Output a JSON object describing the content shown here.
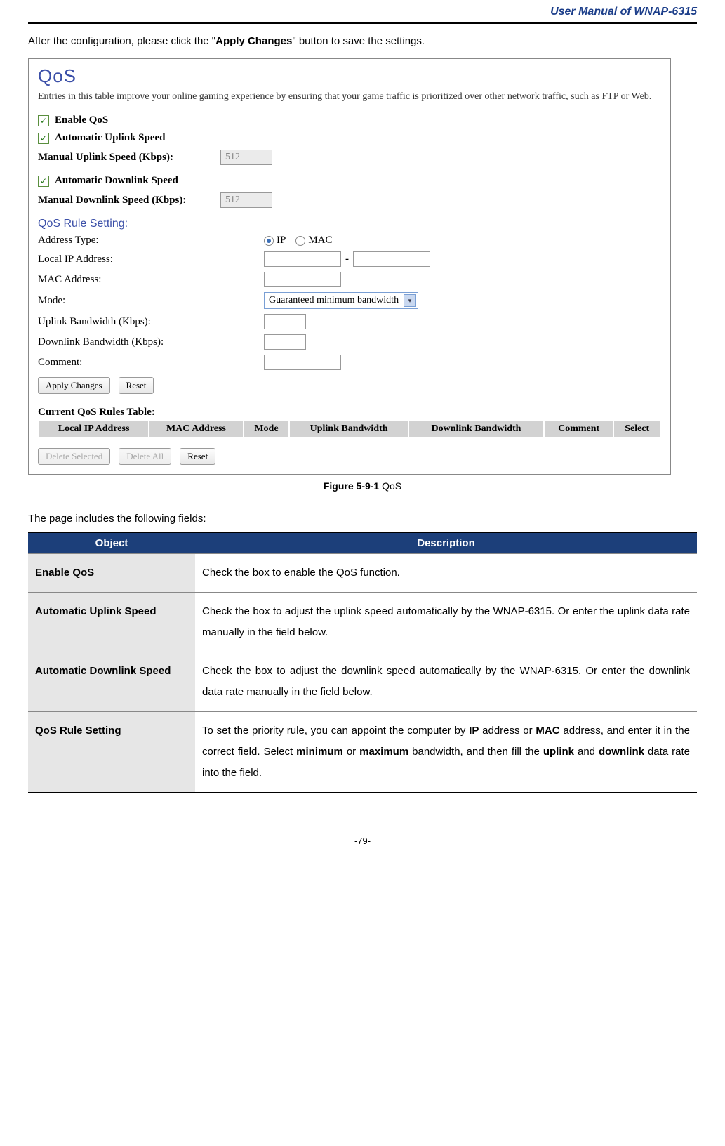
{
  "header": {
    "title": "User Manual of WNAP-6315"
  },
  "intro": {
    "prefix": "After the configuration, please click the \"",
    "bold": "Apply Changes",
    "suffix": "\" button to save the settings."
  },
  "screenshot": {
    "title": "QoS",
    "desc": "Entries in this table improve your online gaming experience by ensuring that your game traffic is prioritized over other network traffic, such as FTP or Web.",
    "enable_qos": "Enable QoS",
    "auto_uplink": "Automatic Uplink Speed",
    "manual_uplink_label": "Manual Uplink Speed (Kbps):",
    "manual_uplink_value": "512",
    "auto_downlink": "Automatic Downlink Speed",
    "manual_downlink_label": "Manual Downlink Speed (Kbps):",
    "manual_downlink_value": "512",
    "rule_setting_heading": "QoS Rule Setting:",
    "address_type_label": "Address Type:",
    "radio_ip": "IP",
    "radio_mac": "MAC",
    "local_ip_label": "Local IP Address:",
    "mac_address_label": "MAC Address:",
    "mode_label": "Mode:",
    "mode_value": "Guaranteed minimum bandwidth",
    "uplink_bw_label": "Uplink Bandwidth (Kbps):",
    "downlink_bw_label": "Downlink Bandwidth (Kbps):",
    "comment_label": "Comment:",
    "apply_changes": "Apply Changes",
    "reset": "Reset",
    "rules_table_heading": "Current QoS Rules Table:",
    "cols": {
      "local_ip": "Local IP Address",
      "mac": "MAC Address",
      "mode": "Mode",
      "uplink": "Uplink Bandwidth",
      "downlink": "Downlink Bandwidth",
      "comment": "Comment",
      "select": "Select"
    },
    "delete_selected": "Delete Selected",
    "delete_all": "Delete All",
    "reset2": "Reset"
  },
  "figure": {
    "bold": "Figure 5-9-1",
    "rest": " QoS"
  },
  "fields_intro": "The page includes the following fields:",
  "desc_table": {
    "header_obj": "Object",
    "header_desc": "Description",
    "rows": [
      {
        "obj": "Enable QoS",
        "desc_plain": "Check the box to enable the QoS function."
      },
      {
        "obj": "Automatic Uplink Speed",
        "desc_plain": "Check the box to adjust the uplink speed automatically by the WNAP-6315. Or enter the uplink data rate manually in the field below."
      },
      {
        "obj": "Automatic Downlink Speed",
        "desc_plain": "Check the box to adjust the downlink speed automatically by the WNAP-6315. Or enter the downlink data rate manually in the field below."
      },
      {
        "obj": "QoS Rule Setting",
        "desc_parts": {
          "p1": "To set the priority rule, you can appoint the computer by ",
          "b1": "IP",
          "p2": " address or ",
          "b2": "MAC",
          "p3": " address, and enter it in the correct field. Select ",
          "b3": "minimum",
          "p4": " or ",
          "b4": "maximum",
          "p5": " bandwidth, and then fill the ",
          "b5": "uplink",
          "p6": " and ",
          "b6": "downlink",
          "p7": " data rate into the field."
        }
      }
    ]
  },
  "page_num": "-79-"
}
